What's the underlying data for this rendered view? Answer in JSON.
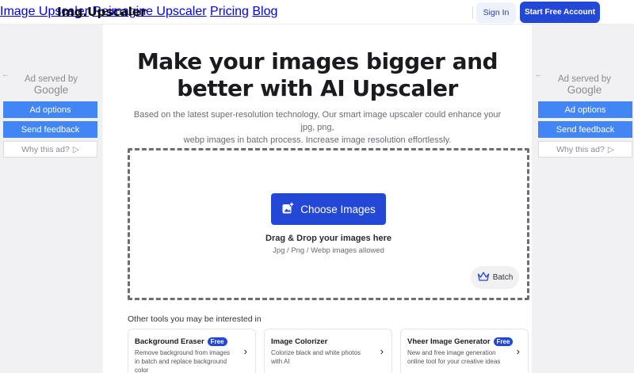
{
  "header": {
    "logo": "Img.Upscaler",
    "nav": [
      "Image Upscaler",
      "Reimagine Upscaler",
      "Pricing",
      "Blog"
    ],
    "sign_in": "Sign In",
    "start_account": "Start Free Account"
  },
  "hero": {
    "title_line1": "Make your images bigger and",
    "title_line2": "better with AI Upscaler",
    "subtitle_line1": "Based on the latest super-resolution technology, Our smart image upscaler could enhance your jpg, png,",
    "subtitle_line2": "webp images in batch process. Increase image resolution effortlessly."
  },
  "upload": {
    "choose_label": "Choose Images",
    "drop_title": "Drag & Drop your images here",
    "drop_sub": "Jpg / Png / Webp images allowed",
    "batch_label": "Batch"
  },
  "tools": {
    "heading": "Other tools you may be interested in",
    "items": [
      {
        "name": "Background Eraser",
        "badge": "Free",
        "desc": "Remove background from images in batch and replace background color"
      },
      {
        "name": "Image Colorizer",
        "badge": "",
        "desc": "Colorize black and white photos with AI"
      },
      {
        "name": "Vheer Image Generator",
        "badge": "Free",
        "desc": "New and free image generation online tool for your creative ideas"
      }
    ]
  },
  "ads": {
    "served_by": "Ad served by",
    "google": "Google",
    "ad_options": "Ad options",
    "send_feedback": "Send feedback",
    "why_this_ad": "Why this ad?"
  },
  "colors": {
    "accent": "#2348d6",
    "ad_blue": "#4285f4"
  }
}
